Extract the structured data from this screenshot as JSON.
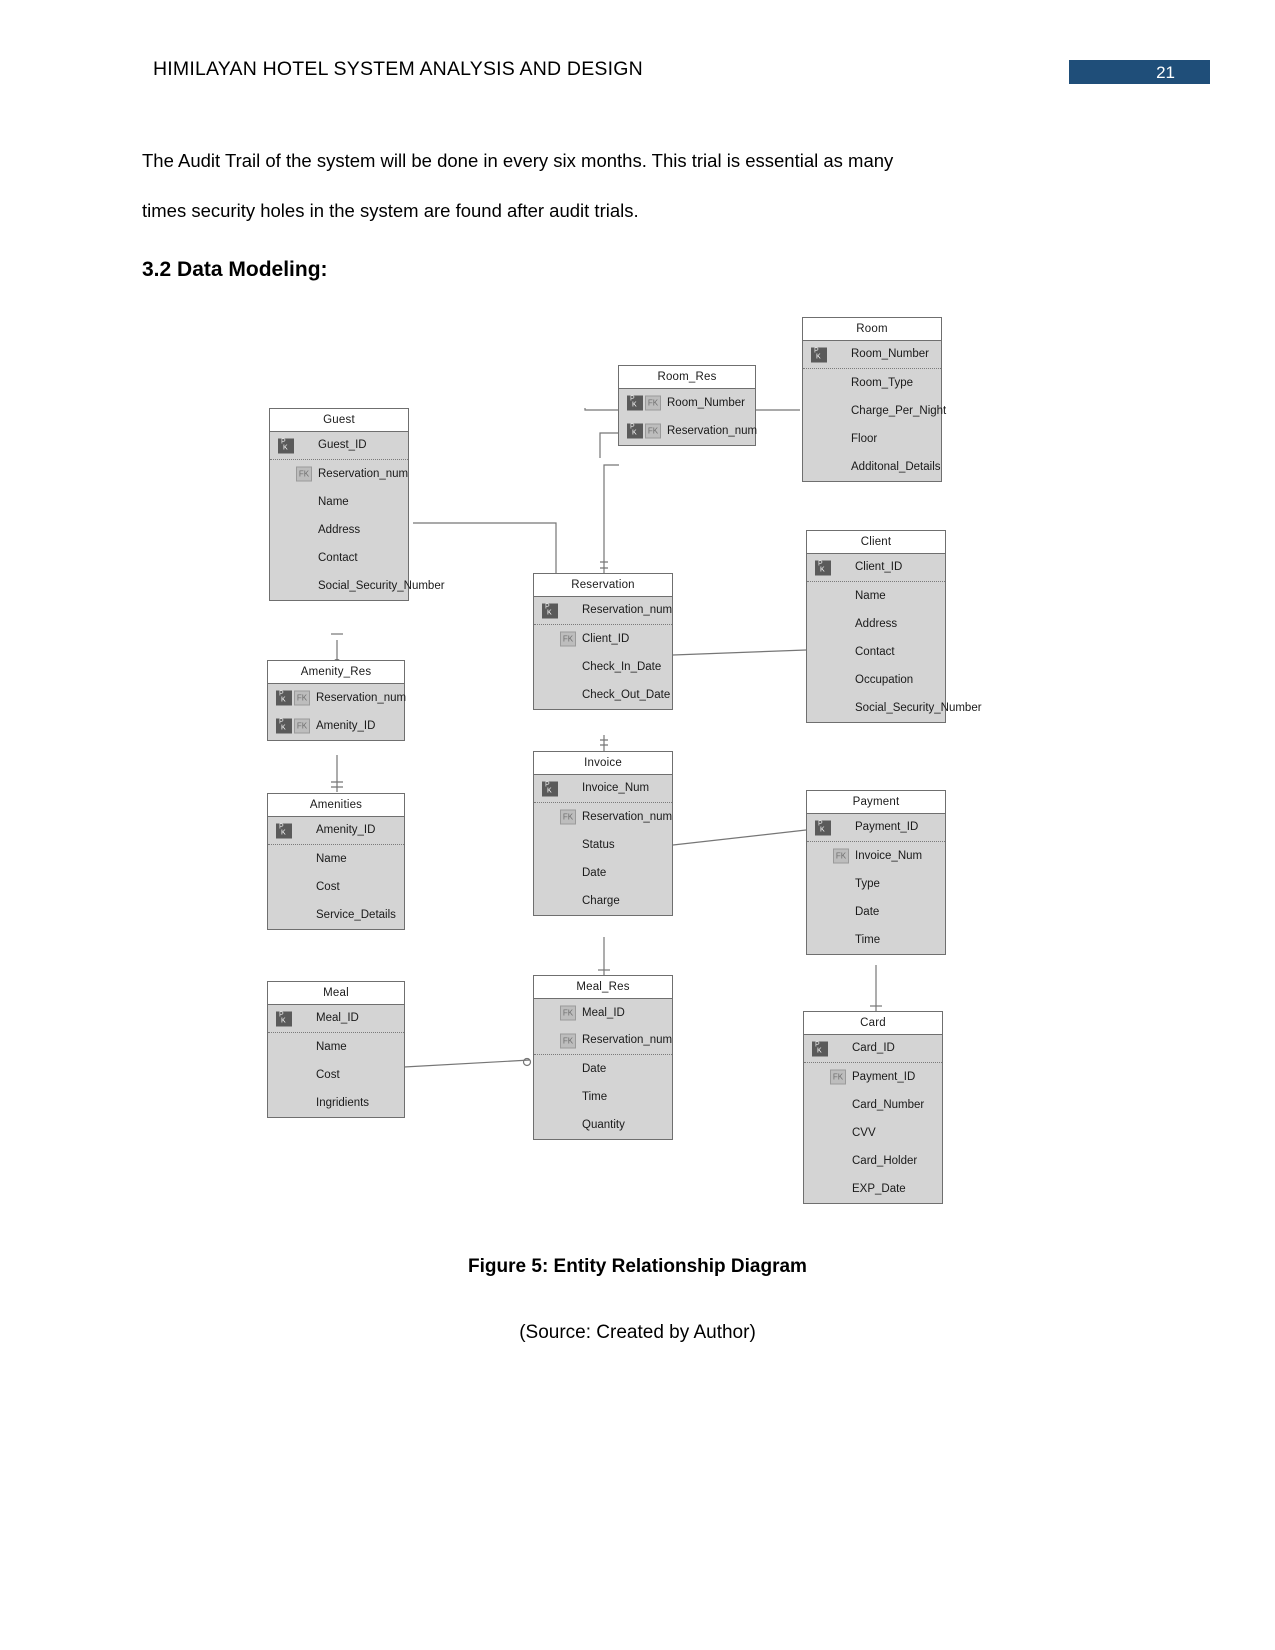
{
  "header": {
    "title": "HIMILAYAN HOTEL SYSTEM ANALYSIS AND DESIGN",
    "page_number": "21",
    "banner_color": "#1F4E79"
  },
  "body": {
    "paragraph_1": "The Audit Trail of the system will be done in every six months. This trial is essential as many",
    "paragraph_2": "times security holes in the system are found after audit trials.",
    "section_heading": "3.2 Data Modeling:",
    "figure_caption": "Figure 5: Entity Relationship Diagram",
    "figure_source": "(Source: Created by Author)"
  },
  "diagram": {
    "type": "entity-relationship-diagram",
    "badge_labels": {
      "pk": "PK",
      "fk": "FK"
    },
    "entities": [
      {
        "name": "Room",
        "attributes": [
          {
            "label": "Room_Number",
            "pk": true,
            "fk": false,
            "sep_after": true
          },
          {
            "label": "Room_Type",
            "pk": false,
            "fk": false
          },
          {
            "label": "Charge_Per_Night",
            "pk": false,
            "fk": false
          },
          {
            "label": "Floor",
            "pk": false,
            "fk": false
          },
          {
            "label": "Additonal_Details",
            "pk": false,
            "fk": false
          }
        ]
      },
      {
        "name": "Room_Res",
        "attributes": [
          {
            "label": "Room_Number",
            "pk": true,
            "fk": true
          },
          {
            "label": "Reservation_num",
            "pk": true,
            "fk": true
          }
        ]
      },
      {
        "name": "Guest",
        "attributes": [
          {
            "label": "Guest_ID",
            "pk": true,
            "fk": false,
            "sep_after": true
          },
          {
            "label": "Reservation_num",
            "pk": false,
            "fk": true
          },
          {
            "label": "Name",
            "pk": false,
            "fk": false
          },
          {
            "label": "Address",
            "pk": false,
            "fk": false
          },
          {
            "label": "Contact",
            "pk": false,
            "fk": false
          },
          {
            "label": "Social_Security_Number",
            "pk": false,
            "fk": false
          }
        ]
      },
      {
        "name": "Reservation",
        "attributes": [
          {
            "label": "Reservation_num",
            "pk": true,
            "fk": false,
            "sep_after": true
          },
          {
            "label": "Client_ID",
            "pk": false,
            "fk": true
          },
          {
            "label": "Check_In_Date",
            "pk": false,
            "fk": false
          },
          {
            "label": "Check_Out_Date",
            "pk": false,
            "fk": false
          }
        ]
      },
      {
        "name": "Client",
        "attributes": [
          {
            "label": "Client_ID",
            "pk": true,
            "fk": false,
            "sep_after": true
          },
          {
            "label": "Name",
            "pk": false,
            "fk": false
          },
          {
            "label": "Address",
            "pk": false,
            "fk": false
          },
          {
            "label": "Contact",
            "pk": false,
            "fk": false
          },
          {
            "label": "Occupation",
            "pk": false,
            "fk": false
          },
          {
            "label": "Social_Security_Number",
            "pk": false,
            "fk": false
          }
        ]
      },
      {
        "name": "Amenity_Res",
        "attributes": [
          {
            "label": "Reservation_num",
            "pk": true,
            "fk": true
          },
          {
            "label": "Amenity_ID",
            "pk": true,
            "fk": true
          }
        ]
      },
      {
        "name": "Amenities",
        "attributes": [
          {
            "label": "Amenity_ID",
            "pk": true,
            "fk": false,
            "sep_after": true
          },
          {
            "label": "Name",
            "pk": false,
            "fk": false
          },
          {
            "label": "Cost",
            "pk": false,
            "fk": false
          },
          {
            "label": "Service_Details",
            "pk": false,
            "fk": false
          }
        ]
      },
      {
        "name": "Invoice",
        "attributes": [
          {
            "label": "Invoice_Num",
            "pk": true,
            "fk": false,
            "sep_after": true
          },
          {
            "label": "Reservation_num",
            "pk": false,
            "fk": true
          },
          {
            "label": "Status",
            "pk": false,
            "fk": false
          },
          {
            "label": "Date",
            "pk": false,
            "fk": false
          },
          {
            "label": "Charge",
            "pk": false,
            "fk": false
          }
        ]
      },
      {
        "name": "Payment",
        "attributes": [
          {
            "label": "Payment_ID",
            "pk": true,
            "fk": false,
            "sep_after": true
          },
          {
            "label": "Invoice_Num",
            "pk": false,
            "fk": true
          },
          {
            "label": "Type",
            "pk": false,
            "fk": false
          },
          {
            "label": "Date",
            "pk": false,
            "fk": false
          },
          {
            "label": "Time",
            "pk": false,
            "fk": false
          }
        ]
      },
      {
        "name": "Meal",
        "attributes": [
          {
            "label": "Meal_ID",
            "pk": true,
            "fk": false,
            "sep_after": true
          },
          {
            "label": "Name",
            "pk": false,
            "fk": false
          },
          {
            "label": "Cost",
            "pk": false,
            "fk": false
          },
          {
            "label": "Ingridients",
            "pk": false,
            "fk": false
          }
        ]
      },
      {
        "name": "Meal_Res",
        "attributes": [
          {
            "label": "Meal_ID",
            "pk": false,
            "fk": true
          },
          {
            "label": "Reservation_num",
            "pk": false,
            "fk": true,
            "sep_after": true
          },
          {
            "label": "Date",
            "pk": false,
            "fk": false
          },
          {
            "label": "Time",
            "pk": false,
            "fk": false
          },
          {
            "label": "Quantity",
            "pk": false,
            "fk": false
          }
        ]
      },
      {
        "name": "Card",
        "attributes": [
          {
            "label": "Card_ID",
            "pk": true,
            "fk": false,
            "sep_after": true
          },
          {
            "label": "Payment_ID",
            "pk": false,
            "fk": true
          },
          {
            "label": "Card_Number",
            "pk": false,
            "fk": false
          },
          {
            "label": "CVV",
            "pk": false,
            "fk": false
          },
          {
            "label": "Card_Holder",
            "pk": false,
            "fk": false
          },
          {
            "label": "EXP_Date",
            "pk": false,
            "fk": false
          }
        ]
      }
    ]
  }
}
